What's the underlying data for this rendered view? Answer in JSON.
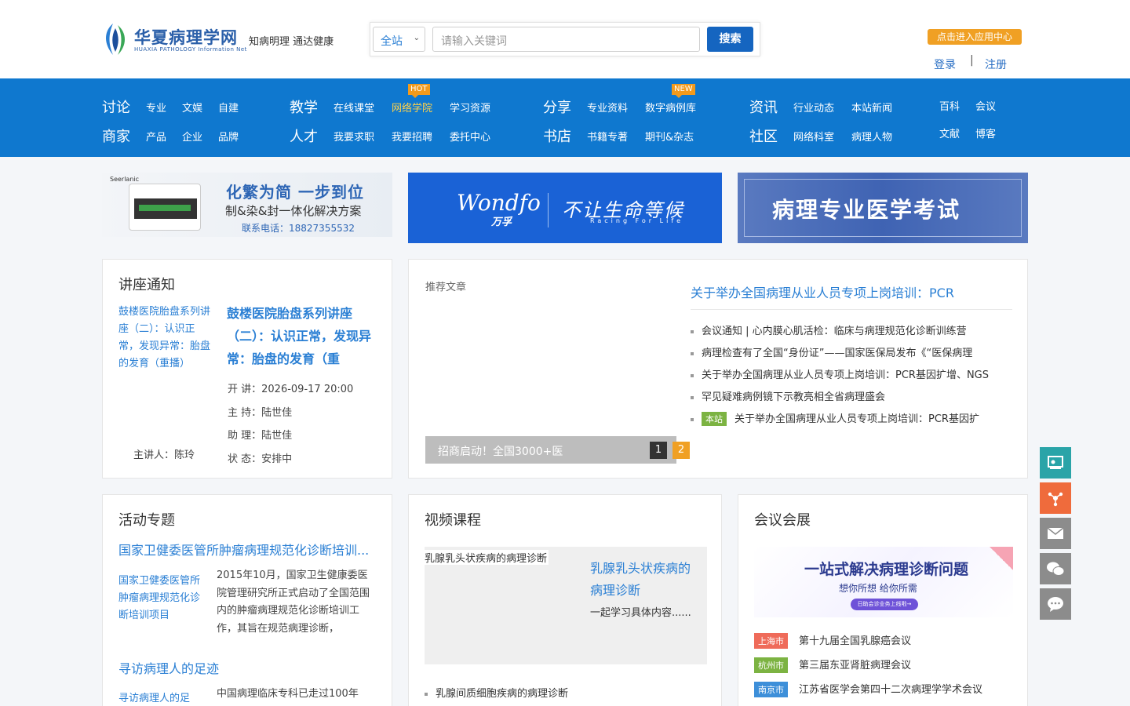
{
  "header": {
    "logo_cn": "华夏病理学网",
    "logo_en": "HUAXIA PATHOLOGY Information Net",
    "slogan": "知病明理 通达健康",
    "search": {
      "scope": "全站",
      "placeholder": "请输入关键词",
      "button": "搜索"
    },
    "app_center": "点击进入应用中心",
    "login": "登录",
    "separator": "|",
    "register": "注册"
  },
  "nav": {
    "groups": [
      {
        "main": "讨论",
        "subs": [
          "专业",
          "文娱",
          "自建"
        ]
      },
      {
        "main": "商家",
        "subs": [
          "产品",
          "企业",
          "品牌"
        ]
      },
      {
        "main": "教学",
        "subs": [
          "在线课堂",
          "网络学院",
          "学习资源"
        ]
      },
      {
        "main": "人才",
        "subs": [
          "我要求职",
          "我要招聘",
          "委托中心"
        ]
      },
      {
        "main": "分享",
        "subs": [
          "专业资料",
          "数字病例库"
        ]
      },
      {
        "main": "书店",
        "subs": [
          "书籍专著",
          "期刊&杂志"
        ]
      },
      {
        "main": "资讯",
        "subs": [
          "行业动态",
          "本站新闻"
        ]
      },
      {
        "main": "社区",
        "subs": [
          "网络科室",
          "病理人物"
        ]
      }
    ],
    "extra": [
      "百科",
      "会议",
      "文献",
      "博客"
    ],
    "badge_hot": "HOT",
    "badge_new": "NEW"
  },
  "banners": {
    "b1": {
      "brand": "Seerlanic",
      "title": "化繁为简 一步到位",
      "subtitle": "制&染&封一体化解决方案",
      "phone": "联系电话：18827355532"
    },
    "b2": {
      "logo": "Wondfo",
      "logo_sub": "万孚",
      "slogan": "不让生命等候",
      "racing": "Racing For Life"
    },
    "b3": {
      "title": "病理专业医学考试"
    }
  },
  "lecture": {
    "heading": "讲座通知",
    "left_title": "鼓楼医院胎盘系列讲座（二）：认识正常，发现异常：胎盘的发育（重播）",
    "title": "鼓楼医院胎盘系列讲座（二）：认识正常，发现异常：胎盘的发育（重",
    "info": [
      "开 讲：2026-09-17 20:00",
      "主 持：陆世佳",
      "助 理：陆世佳",
      "状 态：安排中"
    ],
    "speaker": "主讲人：陈玲"
  },
  "recommend": {
    "label": "推荐文章",
    "slide_caption": "招商启动！全国3000+医",
    "pages": [
      "1",
      "2"
    ],
    "headline": "关于举办全国病理从业人员专项上岗培训：PCR",
    "items": [
      "会议通知 | 心内膜心肌活检：临床与病理规范化诊断训练营",
      "病理检查有了全国“身份证”——国家医保局发布《“医保病理",
      "关于举办全国病理从业人员专项上岗培训：PCR基因扩增、NGS",
      "罕见疑难病例镜下示教亮相全省病理盛会",
      "关于举办全国病理从业人员专项上岗培训：PCR基因扩"
    ],
    "site_tag": "本站"
  },
  "activity": {
    "heading": "活动专题",
    "link1": "国家卫健委医管所肿瘤病理规范化诊断培训...",
    "left1": "国家卫健委医管所肿瘤病理规范化诊断培训项目",
    "right1": "2015年10月，国家卫生健康委医院管理研究所正式启动了全国范围内的肿瘤病理规范化诊断培训工作，其旨在规范病理诊断，",
    "link2": "寻访病理人的足迹",
    "left2": "寻访病理人的足",
    "right2": "中国病理临床专科已走过100年"
  },
  "video": {
    "heading": "视频课程",
    "caption": "乳腺乳头状疾病的病理诊断",
    "title": "乳腺乳头状疾病的病理诊断",
    "desc": "一起学习具体内容......",
    "list_item": "乳腺间质细胞疾病的病理诊断"
  },
  "conference": {
    "heading": "会议会展",
    "banner_title": "一站式解决病理诊断问题",
    "banner_sub": "想你所想  给你所需",
    "banner_pill": "日助会诊业务上线啦→",
    "items": [
      {
        "city": "上海市",
        "name": "第十九届全国乳腺癌会议",
        "color": "#ef6b5a"
      },
      {
        "city": "杭州市",
        "name": "第三届东亚肾脏病理会议",
        "color": "#7cb342"
      },
      {
        "city": "南京市",
        "name": "江苏省医学会第四十二次病理学学术会议",
        "color": "#3d8fd9"
      }
    ]
  },
  "sidebar": [
    {
      "icon": "teacher-board-icon",
      "color": "#2aa4a8"
    },
    {
      "icon": "share-network-icon",
      "color": "#ef6b3c"
    },
    {
      "icon": "mail-icon",
      "color": "#8c8c8c"
    },
    {
      "icon": "wechat-icon",
      "color": "#8c8c8c"
    },
    {
      "icon": "chat-bubble-icon",
      "color": "#8c8c8c"
    }
  ]
}
